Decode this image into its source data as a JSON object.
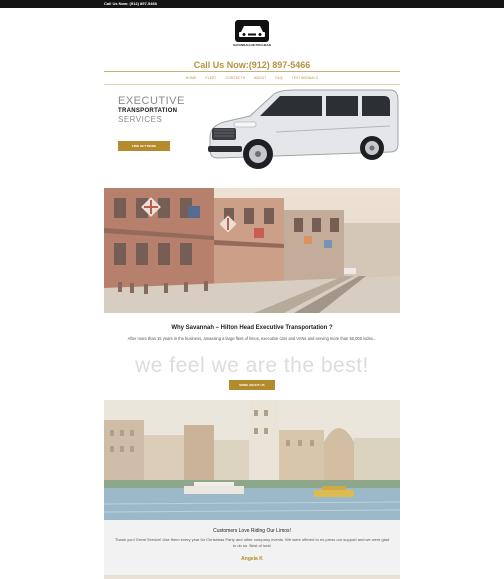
{
  "topbar": {
    "text": "Call Us Now: (912) 897-5466"
  },
  "logo": {
    "name": "SAVANNAH-HILTON HEAD"
  },
  "header": {
    "call_now": "Call Us Now:(912) 897-5466"
  },
  "nav": {
    "items": [
      "HOME",
      "FLEET",
      "CONTACTS",
      "ABOUT",
      "FAQ",
      "TESTIMONIALS"
    ]
  },
  "hero": {
    "line1": "EXECUTIVE",
    "line2": "TRANSPORTATION",
    "line3": "SERVICES",
    "button": "FIND OUT MORE"
  },
  "why": {
    "title": "Why Savannah – Hilton Head Executive Transportation ?",
    "body": "After more than 15 years in the business, amassing a large fleet of limos, executive cars and VANs and serving more than 50,000 index...",
    "tagline": "we feel we are the best!",
    "button": "MORE ABOUT US"
  },
  "testimonial": {
    "title": "Customers Love Riding Our Limos!",
    "quote": "Thank you! Great Service! Use them every year for Christmas Party and other company events. We were offered to ex-press our support and we were glad to do so. Best of luck!",
    "author": "Angela K"
  },
  "colors": {
    "accent": "#b38a2c",
    "topbar": "#141414"
  }
}
